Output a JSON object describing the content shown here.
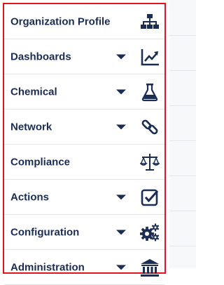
{
  "menu": {
    "items": [
      {
        "label": "Organization Profile",
        "icon": "org-chart-icon",
        "expandable": false
      },
      {
        "label": "Dashboards",
        "icon": "trend-chart-icon",
        "expandable": true
      },
      {
        "label": "Chemical",
        "icon": "flask-icon",
        "expandable": true
      },
      {
        "label": "Network",
        "icon": "link-icon",
        "expandable": true
      },
      {
        "label": "Compliance",
        "icon": "scales-icon",
        "expandable": false
      },
      {
        "label": "Actions",
        "icon": "checkbox-icon",
        "expandable": true
      },
      {
        "label": "Configuration",
        "icon": "gears-icon",
        "expandable": true
      },
      {
        "label": "Administration",
        "icon": "bank-icon",
        "expandable": true
      }
    ]
  },
  "colors": {
    "text": "#1b2d52",
    "highlight_border": "#e0141c",
    "divider": "#e4e6ea"
  }
}
